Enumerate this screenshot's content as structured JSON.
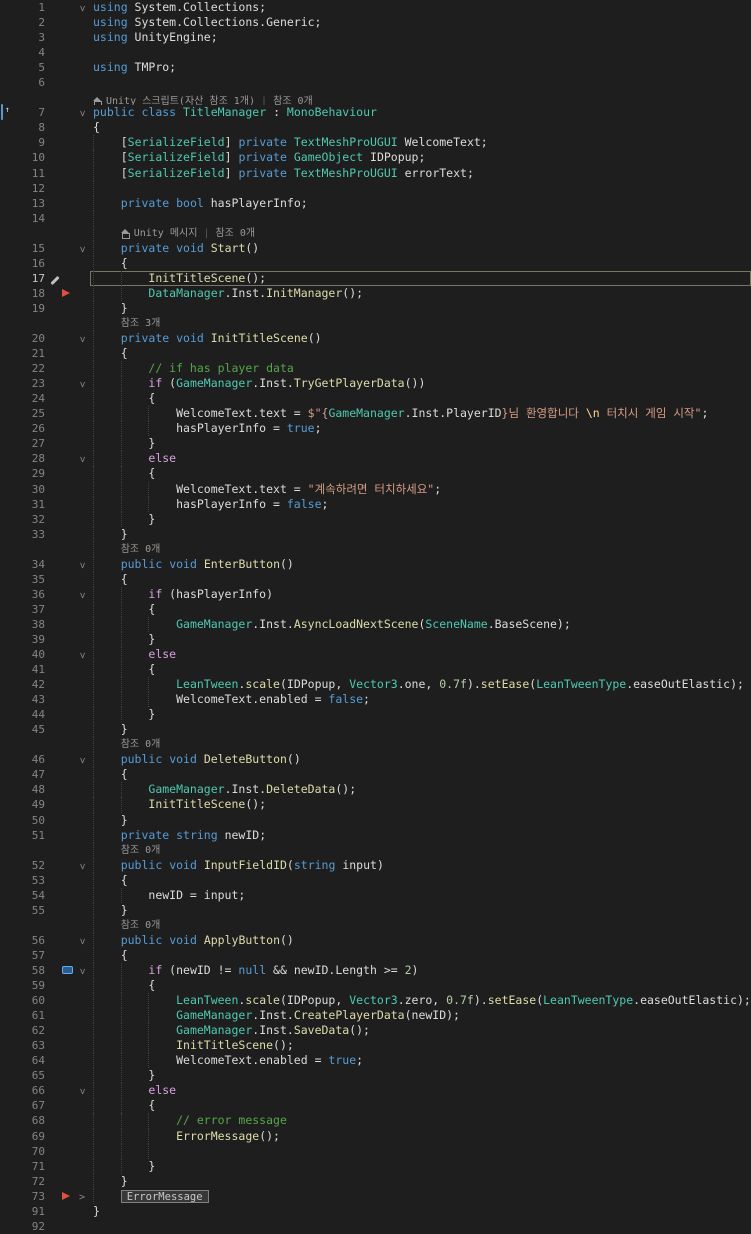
{
  "meta": {
    "app": "visual-studio-code-editor",
    "language": "csharp",
    "colors": {
      "background": "#1e1e1e",
      "keyword": "#569cd6",
      "control_keyword": "#d8a0df",
      "type": "#4ec9b0",
      "method": "#dcdcaa",
      "plain": "#dcdcdc",
      "string": "#d69d85",
      "escape": "#ffd68f",
      "comment": "#57a64a",
      "number": "#b5cea8",
      "line_number": "#858585",
      "codelens_text": "#9a9a9a",
      "current_line_border": "#7a7562",
      "red_marker": "#e14f43",
      "bookmark_border": "#62aef0",
      "indent_guide": "#404040"
    }
  },
  "lines": [
    {
      "n": "1",
      "f": "v",
      "i": 0,
      "g": 0,
      "tk": [
        [
          "kw",
          "using"
        ],
        [
          "pl",
          " System.Collections;"
        ]
      ]
    },
    {
      "n": "2",
      "i": 0,
      "g": 0,
      "tk": [
        [
          "kw",
          "using"
        ],
        [
          "pl",
          " System.Collections.Generic;"
        ]
      ]
    },
    {
      "n": "3",
      "i": 0,
      "g": 0,
      "tk": [
        [
          "kw",
          "using"
        ],
        [
          "pl",
          " UnityEngine;"
        ]
      ]
    },
    {
      "n": "4",
      "g": 0,
      "tk": []
    },
    {
      "n": "5",
      "i": 0,
      "g": 0,
      "tk": [
        [
          "kw",
          "using"
        ],
        [
          "pl",
          " TMPro;"
        ]
      ]
    },
    {
      "n": "6",
      "g": 0,
      "tk": []
    },
    {
      "t": "l",
      "i": 0,
      "g": 0,
      "seg": [
        {
          "icon": true,
          "text": "Unity 스크립트(자산 참조 1개)"
        },
        {
          "text": "참조 0개"
        }
      ]
    },
    {
      "n": "7",
      "f": "v",
      "li": true,
      "i": 0,
      "g": 0,
      "tk": [
        [
          "kw",
          "public"
        ],
        [
          "pl",
          " "
        ],
        [
          "kw",
          "class"
        ],
        [
          "pl",
          " "
        ],
        [
          "ty",
          "TitleManager"
        ],
        [
          "pl",
          " : "
        ],
        [
          "ty",
          "MonoBehaviour"
        ]
      ]
    },
    {
      "n": "8",
      "i": 0,
      "g": 0,
      "tk": [
        [
          "pl",
          "{"
        ]
      ]
    },
    {
      "n": "9",
      "i": 1,
      "g": 1,
      "tk": [
        [
          "pl",
          "["
        ],
        [
          "ty",
          "SerializeField"
        ],
        [
          "pl",
          "] "
        ],
        [
          "kw",
          "private"
        ],
        [
          "pl",
          " "
        ],
        [
          "ty",
          "TextMeshProUGUI"
        ],
        [
          "pl",
          " WelcomeText;"
        ]
      ]
    },
    {
      "n": "10",
      "i": 1,
      "g": 1,
      "tk": [
        [
          "pl",
          "["
        ],
        [
          "ty",
          "SerializeField"
        ],
        [
          "pl",
          "] "
        ],
        [
          "kw",
          "private"
        ],
        [
          "pl",
          " "
        ],
        [
          "ty",
          "GameObject"
        ],
        [
          "pl",
          " IDPopup;"
        ]
      ]
    },
    {
      "n": "11",
      "i": 1,
      "g": 1,
      "tk": [
        [
          "pl",
          "["
        ],
        [
          "ty",
          "SerializeField"
        ],
        [
          "pl",
          "] "
        ],
        [
          "kw",
          "private"
        ],
        [
          "pl",
          " "
        ],
        [
          "ty",
          "TextMeshProUGUI"
        ],
        [
          "pl",
          " errorText;"
        ]
      ]
    },
    {
      "n": "12",
      "g": 1,
      "tk": []
    },
    {
      "n": "13",
      "i": 1,
      "g": 1,
      "tk": [
        [
          "kw",
          "private"
        ],
        [
          "pl",
          " "
        ],
        [
          "kw",
          "bool"
        ],
        [
          "pl",
          " hasPlayerInfo;"
        ]
      ]
    },
    {
      "n": "14",
      "g": 1,
      "tk": []
    },
    {
      "t": "l",
      "i": 1,
      "g": 1,
      "seg": [
        {
          "icon": true,
          "text": "Unity 메시지"
        },
        {
          "text": "참조 0개"
        }
      ]
    },
    {
      "n": "15",
      "f": "v",
      "i": 1,
      "g": 1,
      "tk": [
        [
          "kw",
          "private"
        ],
        [
          "pl",
          " "
        ],
        [
          "kw",
          "void"
        ],
        [
          "pl",
          " "
        ],
        [
          "m",
          "Start"
        ],
        [
          "pl",
          "()"
        ]
      ]
    },
    {
      "n": "16",
      "i": 1,
      "g": 1,
      "tk": [
        [
          "pl",
          "{"
        ]
      ]
    },
    {
      "n": "17",
      "i": 2,
      "g": 2,
      "m": "pencil",
      "hl": true,
      "tk": [
        [
          "m",
          "InitTitleScene"
        ],
        [
          "pl",
          "();"
        ]
      ]
    },
    {
      "n": "18",
      "i": 2,
      "g": 2,
      "m": "arrow",
      "tk": [
        [
          "ty",
          "DataManager"
        ],
        [
          "pl",
          ".Inst."
        ],
        [
          "m",
          "InitManager"
        ],
        [
          "pl",
          "();"
        ]
      ]
    },
    {
      "n": "19",
      "i": 1,
      "g": 1,
      "tk": [
        [
          "pl",
          "}"
        ]
      ]
    },
    {
      "t": "l",
      "i": 1,
      "g": 1,
      "seg": [
        {
          "text": "참조 3개"
        }
      ]
    },
    {
      "n": "20",
      "f": "v",
      "i": 1,
      "g": 1,
      "tk": [
        [
          "kw",
          "private"
        ],
        [
          "pl",
          " "
        ],
        [
          "kw",
          "void"
        ],
        [
          "pl",
          " "
        ],
        [
          "m",
          "InitTitleScene"
        ],
        [
          "pl",
          "()"
        ]
      ]
    },
    {
      "n": "21",
      "i": 1,
      "g": 1,
      "tk": [
        [
          "pl",
          "{"
        ]
      ]
    },
    {
      "n": "22",
      "i": 2,
      "g": 2,
      "tk": [
        [
          "cm",
          "// if has player data"
        ]
      ]
    },
    {
      "n": "23",
      "f": "v",
      "i": 2,
      "g": 2,
      "tk": [
        [
          "ct",
          "if"
        ],
        [
          "pl",
          " ("
        ],
        [
          "ty",
          "GameManager"
        ],
        [
          "pl",
          ".Inst."
        ],
        [
          "m",
          "TryGetPlayerData"
        ],
        [
          "pl",
          "())"
        ]
      ]
    },
    {
      "n": "24",
      "i": 2,
      "g": 2,
      "tk": [
        [
          "pl",
          "{"
        ]
      ]
    },
    {
      "n": "25",
      "i": 3,
      "g": 3,
      "tk": [
        [
          "pl",
          "WelcomeText.text = "
        ],
        [
          "st",
          "$\"{"
        ],
        [
          "ty",
          "GameManager"
        ],
        [
          "pl",
          ".Inst.PlayerID"
        ],
        [
          "st",
          "}님 환영합니다 "
        ],
        [
          "es",
          "\\n"
        ],
        [
          "st",
          " 터치시 게임 시작\""
        ],
        [
          "pl",
          ";"
        ]
      ]
    },
    {
      "n": "26",
      "i": 3,
      "g": 3,
      "tk": [
        [
          "pl",
          "hasPlayerInfo = "
        ],
        [
          "kw",
          "true"
        ],
        [
          "pl",
          ";"
        ]
      ]
    },
    {
      "n": "27",
      "i": 2,
      "g": 2,
      "tk": [
        [
          "pl",
          "}"
        ]
      ]
    },
    {
      "n": "28",
      "f": "v",
      "i": 2,
      "g": 2,
      "tk": [
        [
          "ct",
          "else"
        ]
      ]
    },
    {
      "n": "29",
      "i": 2,
      "g": 2,
      "tk": [
        [
          "pl",
          "{"
        ]
      ]
    },
    {
      "n": "30",
      "i": 3,
      "g": 3,
      "tk": [
        [
          "pl",
          "WelcomeText.text = "
        ],
        [
          "st",
          "\"계속하려면 터치하세요\""
        ],
        [
          "pl",
          ";"
        ]
      ]
    },
    {
      "n": "31",
      "i": 3,
      "g": 3,
      "tk": [
        [
          "pl",
          "hasPlayerInfo = "
        ],
        [
          "kw",
          "false"
        ],
        [
          "pl",
          ";"
        ]
      ]
    },
    {
      "n": "32",
      "i": 2,
      "g": 2,
      "tk": [
        [
          "pl",
          "}"
        ]
      ]
    },
    {
      "n": "33",
      "i": 1,
      "g": 1,
      "tk": [
        [
          "pl",
          "}"
        ]
      ]
    },
    {
      "t": "l",
      "i": 1,
      "g": 1,
      "seg": [
        {
          "text": "참조 0개"
        }
      ]
    },
    {
      "n": "34",
      "f": "v",
      "i": 1,
      "g": 1,
      "tk": [
        [
          "kw",
          "public"
        ],
        [
          "pl",
          " "
        ],
        [
          "kw",
          "void"
        ],
        [
          "pl",
          " "
        ],
        [
          "m",
          "EnterButton"
        ],
        [
          "pl",
          "()"
        ]
      ]
    },
    {
      "n": "35",
      "i": 1,
      "g": 1,
      "tk": [
        [
          "pl",
          "{"
        ]
      ]
    },
    {
      "n": "36",
      "f": "v",
      "i": 2,
      "g": 2,
      "tk": [
        [
          "ct",
          "if"
        ],
        [
          "pl",
          " (hasPlayerInfo)"
        ]
      ]
    },
    {
      "n": "37",
      "i": 2,
      "g": 2,
      "tk": [
        [
          "pl",
          "{"
        ]
      ]
    },
    {
      "n": "38",
      "i": 3,
      "g": 3,
      "tk": [
        [
          "ty",
          "GameManager"
        ],
        [
          "pl",
          ".Inst."
        ],
        [
          "m",
          "AsyncLoadNextScene"
        ],
        [
          "pl",
          "("
        ],
        [
          "ty",
          "SceneName"
        ],
        [
          "pl",
          ".BaseScene);"
        ]
      ]
    },
    {
      "n": "39",
      "i": 2,
      "g": 2,
      "tk": [
        [
          "pl",
          "}"
        ]
      ]
    },
    {
      "n": "40",
      "f": "v",
      "i": 2,
      "g": 2,
      "tk": [
        [
          "ct",
          "else"
        ]
      ]
    },
    {
      "n": "41",
      "i": 2,
      "g": 2,
      "tk": [
        [
          "pl",
          "{"
        ]
      ]
    },
    {
      "n": "42",
      "i": 3,
      "g": 3,
      "tk": [
        [
          "ty",
          "LeanTween"
        ],
        [
          "pl",
          "."
        ],
        [
          "m",
          "scale"
        ],
        [
          "pl",
          "(IDPopup, "
        ],
        [
          "ty",
          "Vector3"
        ],
        [
          "pl",
          ".one, "
        ],
        [
          "nu",
          "0.7f"
        ],
        [
          "pl",
          ")."
        ],
        [
          "m",
          "setEase"
        ],
        [
          "pl",
          "("
        ],
        [
          "ty",
          "LeanTweenType"
        ],
        [
          "pl",
          ".easeOutElastic);"
        ]
      ]
    },
    {
      "n": "43",
      "i": 3,
      "g": 3,
      "tk": [
        [
          "pl",
          "WelcomeText.enabled = "
        ],
        [
          "kw",
          "false"
        ],
        [
          "pl",
          ";"
        ]
      ]
    },
    {
      "n": "44",
      "i": 2,
      "g": 2,
      "tk": [
        [
          "pl",
          "}"
        ]
      ]
    },
    {
      "n": "45",
      "i": 1,
      "g": 1,
      "tk": [
        [
          "pl",
          "}"
        ]
      ]
    },
    {
      "t": "l",
      "i": 1,
      "g": 1,
      "seg": [
        {
          "text": "참조 0개"
        }
      ]
    },
    {
      "n": "46",
      "f": "v",
      "i": 1,
      "g": 1,
      "tk": [
        [
          "kw",
          "public"
        ],
        [
          "pl",
          " "
        ],
        [
          "kw",
          "void"
        ],
        [
          "pl",
          " "
        ],
        [
          "m",
          "DeleteButton"
        ],
        [
          "pl",
          "()"
        ]
      ]
    },
    {
      "n": "47",
      "i": 1,
      "g": 1,
      "tk": [
        [
          "pl",
          "{"
        ]
      ]
    },
    {
      "n": "48",
      "i": 2,
      "g": 2,
      "tk": [
        [
          "ty",
          "GameManager"
        ],
        [
          "pl",
          ".Inst."
        ],
        [
          "m",
          "DeleteData"
        ],
        [
          "pl",
          "();"
        ]
      ]
    },
    {
      "n": "49",
      "i": 2,
      "g": 2,
      "tk": [
        [
          "m",
          "InitTitleScene"
        ],
        [
          "pl",
          "();"
        ]
      ]
    },
    {
      "n": "50",
      "i": 1,
      "g": 1,
      "tk": [
        [
          "pl",
          "}"
        ]
      ]
    },
    {
      "n": "51",
      "i": 1,
      "g": 1,
      "tk": [
        [
          "kw",
          "private"
        ],
        [
          "pl",
          " "
        ],
        [
          "kw",
          "string"
        ],
        [
          "pl",
          " newID;"
        ]
      ]
    },
    {
      "t": "l",
      "i": 1,
      "g": 1,
      "seg": [
        {
          "text": "참조 0개"
        }
      ]
    },
    {
      "n": "52",
      "f": "v",
      "i": 1,
      "g": 1,
      "tk": [
        [
          "kw",
          "public"
        ],
        [
          "pl",
          " "
        ],
        [
          "kw",
          "void"
        ],
        [
          "pl",
          " "
        ],
        [
          "m",
          "InputFieldID"
        ],
        [
          "pl",
          "("
        ],
        [
          "kw",
          "string"
        ],
        [
          "pl",
          " input)"
        ]
      ]
    },
    {
      "n": "53",
      "i": 1,
      "g": 1,
      "tk": [
        [
          "pl",
          "{"
        ]
      ]
    },
    {
      "n": "54",
      "i": 2,
      "g": 2,
      "tk": [
        [
          "pl",
          "newID = input;"
        ]
      ]
    },
    {
      "n": "55",
      "i": 1,
      "g": 1,
      "tk": [
        [
          "pl",
          "}"
        ]
      ]
    },
    {
      "t": "l",
      "i": 1,
      "g": 1,
      "seg": [
        {
          "text": "참조 0개"
        }
      ]
    },
    {
      "n": "56",
      "f": "v",
      "i": 1,
      "g": 1,
      "tk": [
        [
          "kw",
          "public"
        ],
        [
          "pl",
          " "
        ],
        [
          "kw",
          "void"
        ],
        [
          "pl",
          " "
        ],
        [
          "m",
          "ApplyButton"
        ],
        [
          "pl",
          "()"
        ]
      ]
    },
    {
      "n": "57",
      "i": 1,
      "g": 1,
      "tk": [
        [
          "pl",
          "{"
        ]
      ]
    },
    {
      "n": "58",
      "f": "v",
      "i": 2,
      "g": 2,
      "m": "bookmark",
      "tk": [
        [
          "ct",
          "if"
        ],
        [
          "pl",
          " (newID != "
        ],
        [
          "kw",
          "null"
        ],
        [
          "pl",
          " && newID.Length >= "
        ],
        [
          "nu",
          "2"
        ],
        [
          "pl",
          ")"
        ]
      ]
    },
    {
      "n": "59",
      "i": 2,
      "g": 2,
      "tk": [
        [
          "pl",
          "{"
        ]
      ]
    },
    {
      "n": "60",
      "i": 3,
      "g": 3,
      "tk": [
        [
          "ty",
          "LeanTween"
        ],
        [
          "pl",
          "."
        ],
        [
          "m",
          "scale"
        ],
        [
          "pl",
          "(IDPopup, "
        ],
        [
          "ty",
          "Vector3"
        ],
        [
          "pl",
          ".zero, "
        ],
        [
          "nu",
          "0.7f"
        ],
        [
          "pl",
          ")."
        ],
        [
          "m",
          "setEase"
        ],
        [
          "pl",
          "("
        ],
        [
          "ty",
          "LeanTweenType"
        ],
        [
          "pl",
          ".easeOutElastic);"
        ]
      ]
    },
    {
      "n": "61",
      "i": 3,
      "g": 3,
      "tk": [
        [
          "ty",
          "GameManager"
        ],
        [
          "pl",
          ".Inst."
        ],
        [
          "m",
          "CreatePlayerData"
        ],
        [
          "pl",
          "(newID);"
        ]
      ]
    },
    {
      "n": "62",
      "i": 3,
      "g": 3,
      "tk": [
        [
          "ty",
          "GameManager"
        ],
        [
          "pl",
          ".Inst."
        ],
        [
          "m",
          "SaveData"
        ],
        [
          "pl",
          "();"
        ]
      ]
    },
    {
      "n": "63",
      "i": 3,
      "g": 3,
      "tk": [
        [
          "m",
          "InitTitleScene"
        ],
        [
          "pl",
          "();"
        ]
      ]
    },
    {
      "n": "64",
      "i": 3,
      "g": 3,
      "tk": [
        [
          "pl",
          "WelcomeText.enabled = "
        ],
        [
          "kw",
          "true"
        ],
        [
          "pl",
          ";"
        ]
      ]
    },
    {
      "n": "65",
      "i": 2,
      "g": 2,
      "tk": [
        [
          "pl",
          "}"
        ]
      ]
    },
    {
      "n": "66",
      "f": "v",
      "i": 2,
      "g": 2,
      "tk": [
        [
          "ct",
          "else"
        ]
      ]
    },
    {
      "n": "67",
      "i": 2,
      "g": 2,
      "tk": [
        [
          "pl",
          "{"
        ]
      ]
    },
    {
      "n": "68",
      "i": 3,
      "g": 3,
      "tk": [
        [
          "cm",
          "// error message"
        ]
      ]
    },
    {
      "n": "69",
      "i": 3,
      "g": 3,
      "tk": [
        [
          "m",
          "ErrorMessage"
        ],
        [
          "pl",
          "();"
        ]
      ]
    },
    {
      "n": "70",
      "g": 3,
      "tk": []
    },
    {
      "n": "71",
      "i": 2,
      "g": 2,
      "tk": [
        [
          "pl",
          "}"
        ]
      ]
    },
    {
      "n": "72",
      "i": 1,
      "g": 1,
      "tk": [
        [
          "pl",
          "}"
        ]
      ]
    },
    {
      "n": "73",
      "f": ">",
      "i": 1,
      "g": 1,
      "m": "arrow",
      "col": "ErrorMessage"
    },
    {
      "n": "91",
      "i": 0,
      "g": 0,
      "tk": [
        [
          "pl",
          "}"
        ]
      ]
    },
    {
      "n": "92",
      "g": 0,
      "tk": []
    }
  ]
}
